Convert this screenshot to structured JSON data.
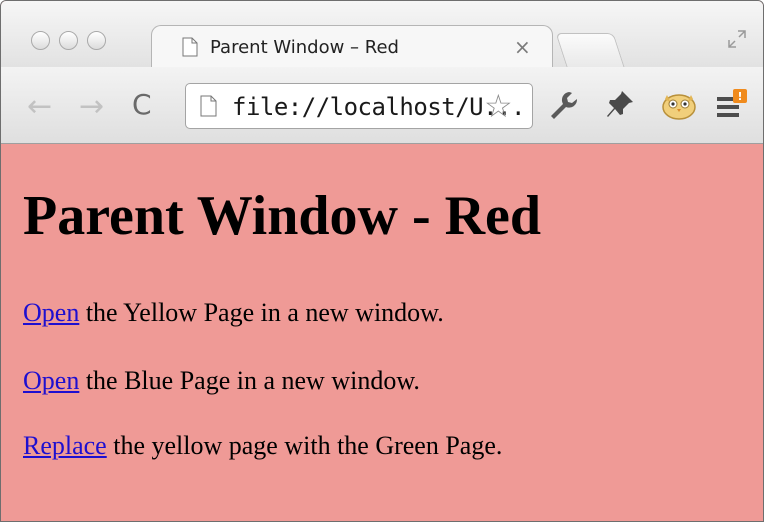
{
  "tab": {
    "title": "Parent Window – Red",
    "close": "×"
  },
  "toolbar": {
    "back": "←",
    "forward": "→",
    "reload": "C",
    "url": "file://localhost/U...",
    "star": "☆"
  },
  "icons": {
    "tab_page": "page-icon",
    "fullscreen": "fullscreen-icon",
    "wrench": "wrench-icon",
    "pin": "pin-icon",
    "extension": "owl-icon",
    "menu": "menu-icon"
  },
  "page": {
    "heading": "Parent Window - Red",
    "lines": [
      {
        "link": "Open",
        "text": " the Yellow Page in a new window."
      },
      {
        "link": "Open",
        "text": " the Blue Page in a new window."
      },
      {
        "link": "Replace",
        "text": " the yellow page with the Green Page."
      }
    ]
  },
  "colors": {
    "page_background": "#ef9a96",
    "link": "#1e0fd0"
  }
}
